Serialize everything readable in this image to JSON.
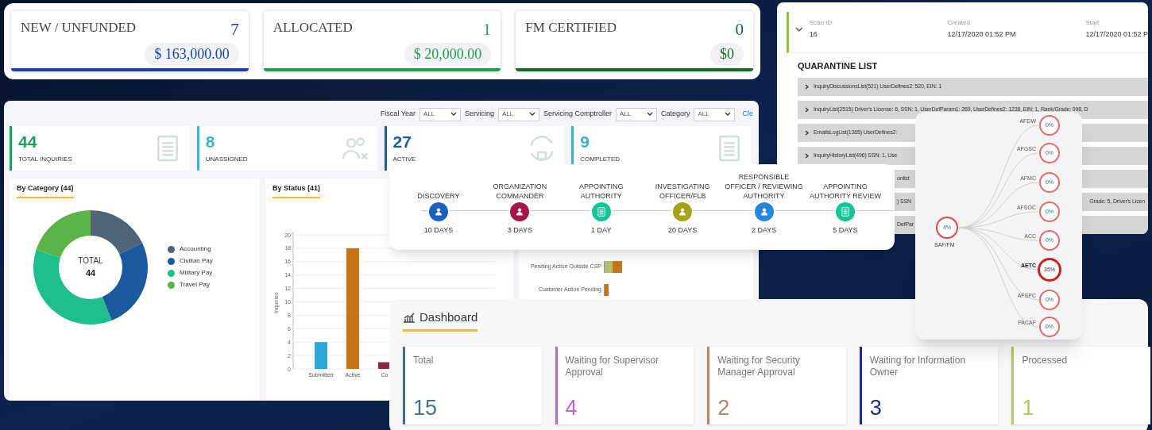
{
  "funding_cards": [
    {
      "label": "NEW / UNFUNDED",
      "count": "7",
      "amount": "$ 163,000.00",
      "color": "#1a3fb0"
    },
    {
      "label": "ALLOCATED",
      "count": "1",
      "amount": "$ 20,000.00",
      "color": "#1f9e4f"
    },
    {
      "label": "FM CERTIFIED",
      "count": "0",
      "amount": "$0",
      "color": "#146b2a"
    }
  ],
  "inquiries": {
    "filters": [
      {
        "label": "Fiscal Year",
        "value": "ALL"
      },
      {
        "label": "Servicing",
        "value": "ALL"
      },
      {
        "label": "Servicing Comptroller",
        "value": "ALL"
      },
      {
        "label": "Category",
        "value": "ALL"
      }
    ],
    "clear_link": "Cle",
    "stats": [
      {
        "value": "44",
        "label": "TOTAL INQUIRIES",
        "color": "#1f9e5a",
        "kind": "document"
      },
      {
        "value": "8",
        "label": "UNASSIGNED",
        "color": "#3bb3c3",
        "kind": "people"
      },
      {
        "value": "27",
        "label": "ACTIVE",
        "color": "#1f5c99",
        "kind": "sync"
      },
      {
        "value": "9",
        "label": "COMPLETED",
        "color": "#3bb3c3",
        "kind": "document"
      }
    ],
    "by_category": {
      "title": "By Category (44)",
      "center_label": "TOTAL",
      "center_value": "44",
      "legend": [
        {
          "label": "Accounting",
          "color": "#4f6475"
        },
        {
          "label": "Civilian Pay",
          "color": "#1c5aa0"
        },
        {
          "label": "Military Pay",
          "color": "#1dbf8f"
        },
        {
          "label": "Travel Pay",
          "color": "#5bb54a"
        }
      ]
    },
    "by_status": {
      "title": "By Status (41)",
      "chart_data": {
        "type": "bar",
        "ylabel": "Inquiries",
        "categories": [
          "Submitted",
          "Active",
          "Co"
        ],
        "series": [
          {
            "color": "#2ba6d6",
            "values": [
              4,
              null,
              null
            ]
          },
          {
            "color": "#c77418",
            "values": [
              null,
              18,
              null
            ]
          },
          {
            "color": "#8a2a3f",
            "values": [
              null,
              null,
              1
            ]
          }
        ],
        "stacked": true,
        "grid": true,
        "ylim": [
          0,
          20
        ],
        "yticks": [
          0,
          2,
          4,
          6,
          8,
          10,
          12,
          14,
          16,
          18,
          20
        ]
      }
    },
    "status_rows": [
      {
        "label": "Pending Action Outside CSP"
      },
      {
        "label": "Customer Action Pending"
      }
    ]
  },
  "scan": {
    "fields": [
      {
        "label": "Scan ID",
        "value": "16"
      },
      {
        "label": "Created",
        "value": "12/17/2020 01:52 PM"
      },
      {
        "label": "Start",
        "value": "12/17/2020 01:52 P"
      }
    ],
    "title": "QUARANTINE LIST",
    "rows": [
      {
        "kind": "full",
        "segments": [
          "InquiryDiscussionsList(521) UserDefines2: 520, EIN: 1"
        ]
      },
      {
        "kind": "full",
        "segments": [
          "InquiryList(2515) Driver's License: 6, SSN: 1, UserDefParam1: 269, UserDefines2: 1238, EIN: 1, Rank/Grade: 998, D"
        ]
      },
      {
        "kind": "full",
        "segments": [
          "EmailsLogList(1365) UserDefines2:"
        ]
      },
      {
        "kind": "full",
        "segments": [
          "InquiryHistoryList(496) SSN: 1, Use"
        ]
      },
      {
        "kind": "partial",
        "segments": [
          "onlist"
        ]
      },
      {
        "kind": "partial",
        "segments": [
          ") SSN",
          "Grade: 5, Driver's Licen"
        ]
      },
      {
        "kind": "partial",
        "segments": [
          "DefPar"
        ]
      }
    ]
  },
  "org_chart": {
    "root": {
      "label": "SAF/FM",
      "percent": "4%"
    },
    "children": [
      {
        "label": "AFDW",
        "percent": "0%",
        "selected": false
      },
      {
        "label": "AFGSC",
        "percent": "0%",
        "selected": false
      },
      {
        "label": "AFMC",
        "percent": "0%",
        "selected": false
      },
      {
        "label": "AFSOC",
        "percent": "0%",
        "selected": false
      },
      {
        "label": "ACC",
        "percent": "0%",
        "selected": false
      },
      {
        "label": "AETC",
        "percent": "35%",
        "selected": true
      },
      {
        "label": "AFSPC",
        "percent": "0%",
        "selected": false
      },
      {
        "label": "PACAF",
        "percent": "0%",
        "selected": false
      }
    ]
  },
  "timeline": [
    {
      "label": "DISCOVERY",
      "days": "10 DAYS",
      "color": "#1d5fbf",
      "kind": "person"
    },
    {
      "label": "ORGANIZATION COMMANDER",
      "days": "3 DAYS",
      "color": "#a3174a",
      "kind": "person"
    },
    {
      "label": "APPOINTING AUTHORITY",
      "days": "1 DAY",
      "color": "#16c49a",
      "kind": "document"
    },
    {
      "label": "INVESTIGATING OFFICER/FLB",
      "days": "20 DAYS",
      "color": "#a3a41a",
      "kind": "person"
    },
    {
      "label": "RESPONSIBLE OFFICER / REVIEWING AUTHORITY",
      "days": "2 DAYS",
      "color": "#2787d6",
      "kind": "person"
    },
    {
      "label": "APPOINTING AUTHORITY REVIEW",
      "days": "5 DAYS",
      "color": "#16c49a",
      "kind": "document"
    }
  ],
  "dashboard": {
    "title": "Dashboard",
    "cards": [
      {
        "label": "Total",
        "value": "15",
        "color": "#4a6f8a"
      },
      {
        "label": "Waiting for Supervisor Approval",
        "value": "4",
        "color": "#b76bc2"
      },
      {
        "label": "Waiting for Security Manager Approval",
        "value": "2",
        "color": "#b08a64"
      },
      {
        "label": "Waiting for Information Owner",
        "value": "3",
        "color": "#1f2d86"
      },
      {
        "label": "Processed",
        "value": "1",
        "color": "#b9c45a"
      }
    ]
  }
}
